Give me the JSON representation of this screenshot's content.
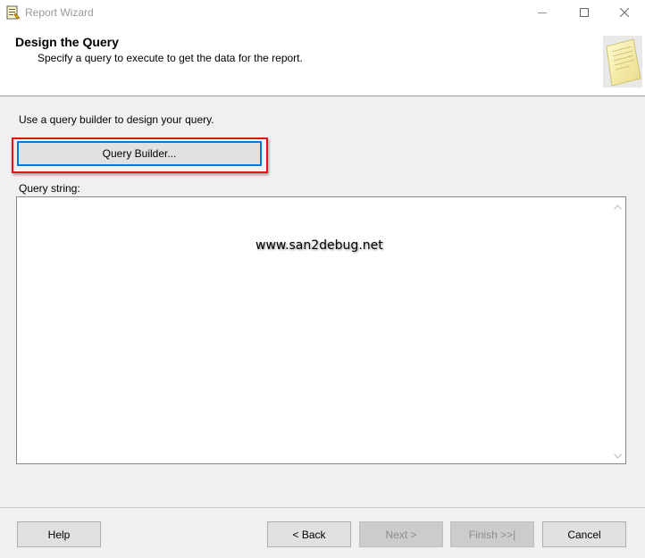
{
  "window": {
    "title": "Report Wizard",
    "icon": "report-wizard-icon"
  },
  "header": {
    "title": "Design the Query",
    "subtitle": "Specify a query to execute to get the data for the report.",
    "graphic": "wizard-document-graphic"
  },
  "body": {
    "instruction": "Use a query builder to design your query.",
    "query_builder_label": "Query Builder...",
    "query_string_label": "Query string:",
    "query_string_value": "",
    "highlight_color": "#e0141c"
  },
  "watermark": "www.san2debug.net",
  "footer": {
    "help_label": "Help",
    "back_label": "< Back",
    "next_label": "Next >",
    "finish_label": "Finish >>|",
    "cancel_label": "Cancel"
  },
  "colors": {
    "focus_blue": "#0078d7",
    "dialog_bg": "#f0f0f0"
  }
}
